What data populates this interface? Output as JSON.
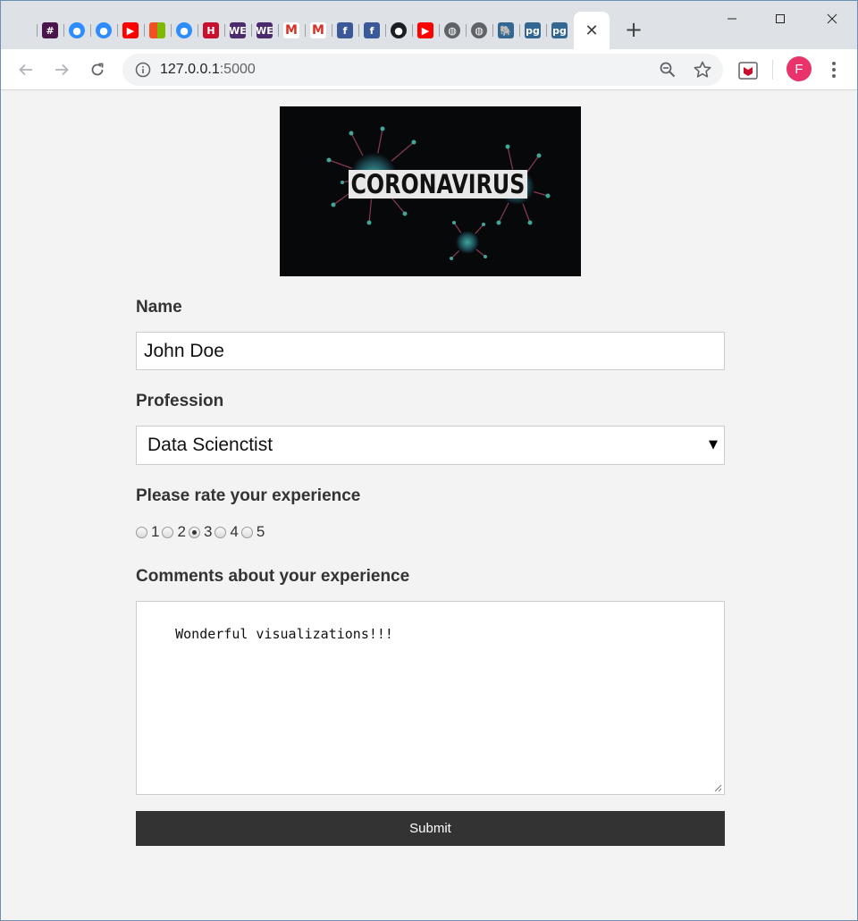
{
  "browser": {
    "tab_favicons": [
      {
        "name": "apple",
        "color": "#6b6b6b",
        "glyph": ""
      },
      {
        "name": "slack",
        "color": "#4a154b",
        "glyph": "#"
      },
      {
        "name": "zoom",
        "color": "#2d8cff",
        "glyph": "●"
      },
      {
        "name": "zoom",
        "color": "#2d8cff",
        "glyph": "●"
      },
      {
        "name": "youtube",
        "color": "#ff0000",
        "glyph": "▶"
      },
      {
        "name": "microsoft",
        "color": "#f25022",
        "glyph": ""
      },
      {
        "name": "zoom",
        "color": "#2d8cff",
        "glyph": "●"
      },
      {
        "name": "harvard",
        "color": "#c8102e",
        "glyph": "H"
      },
      {
        "name": "we",
        "color": "#4b2a6e",
        "glyph": "WE"
      },
      {
        "name": "we",
        "color": "#4b2a6e",
        "glyph": "WE"
      },
      {
        "name": "gmail",
        "color": "#ffffff",
        "glyph": "M"
      },
      {
        "name": "gmail",
        "color": "#ffffff",
        "glyph": "M"
      },
      {
        "name": "facebook",
        "color": "#3b5998",
        "glyph": "f"
      },
      {
        "name": "facebook",
        "color": "#3b5998",
        "glyph": "f"
      },
      {
        "name": "github",
        "color": "#1b1f23",
        "glyph": "●"
      },
      {
        "name": "youtube",
        "color": "#ff0000",
        "glyph": "▶"
      },
      {
        "name": "globe",
        "color": "#5f6368",
        "glyph": "◍"
      },
      {
        "name": "globe",
        "color": "#5f6368",
        "glyph": "◍"
      },
      {
        "name": "postgres",
        "color": "#336791",
        "glyph": "🐘"
      },
      {
        "name": "pg",
        "color": "#336791",
        "glyph": "pg"
      },
      {
        "name": "pg",
        "color": "#336791",
        "glyph": "pg"
      }
    ],
    "active_tab_close": "✕",
    "new_tab": "+",
    "url_host": "127.0.0.1",
    "url_port": ":5000",
    "avatar_letter": "F"
  },
  "banner": {
    "word": "CORONAVIRUS"
  },
  "form": {
    "name_label": "Name",
    "name_value": "John Doe",
    "profession_label": "Profession",
    "profession_value": "Data Scienctist",
    "rating_label": "Please rate your experience",
    "rating_options": [
      "1",
      "2",
      "3",
      "4",
      "5"
    ],
    "rating_selected": "3",
    "comments_label": "Comments about your experience",
    "comments_value": "Wonderful visualizations!!!",
    "submit_label": "Submit"
  }
}
